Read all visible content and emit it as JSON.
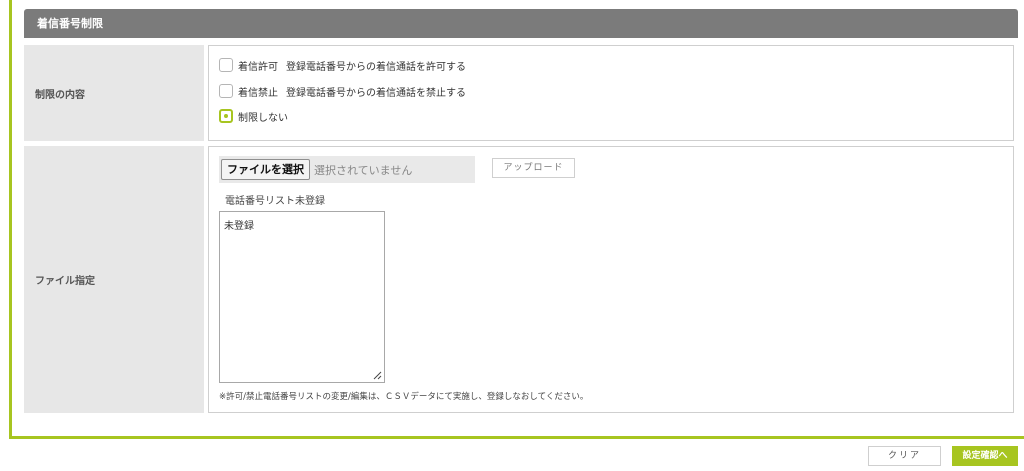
{
  "section": {
    "title": "着信番号制限"
  },
  "restriction": {
    "label": "制限の内容",
    "options": [
      {
        "main": "着信許可",
        "desc": "登録電話番号からの着信通話を許可する",
        "selected": false
      },
      {
        "main": "着信禁止",
        "desc": "登録電話番号からの着信通話を禁止する",
        "selected": false
      },
      {
        "main": "制限しない",
        "desc": "",
        "selected": true
      }
    ]
  },
  "file": {
    "label": "ファイル指定",
    "choose_button": "ファイルを選択",
    "no_file_text": "選択されていません",
    "upload_button": "アップロード",
    "list_status": "電話番号リスト未登録",
    "list_content": "未登録",
    "note": "※許可/禁止電話番号リストの変更/編集は、ＣＳＶデータにて実施し、登録しなおしてください。"
  },
  "footer": {
    "clear_button": "クリア",
    "confirm_button": "設定確認へ"
  },
  "colors": {
    "accent": "#a7c520",
    "header_bg": "#7b7b7b",
    "label_bg": "#e7e7e7"
  }
}
